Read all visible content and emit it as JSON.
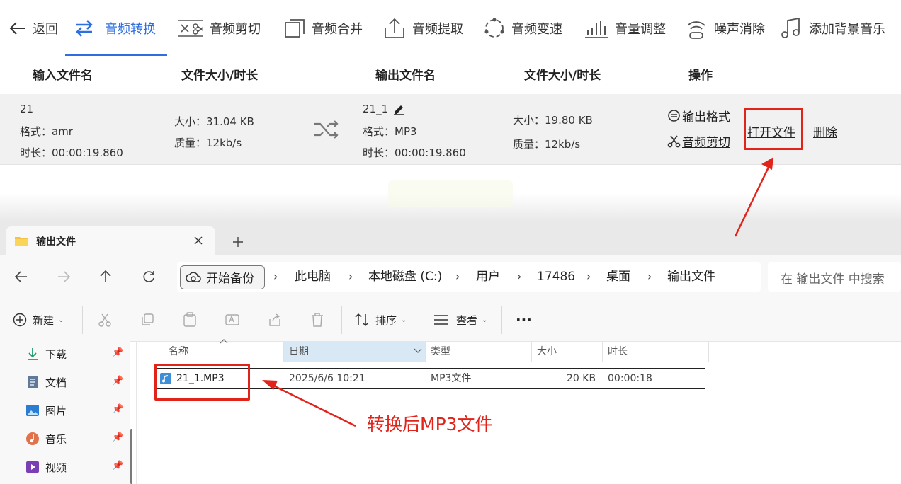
{
  "toolbar": {
    "back_label": "返回",
    "items": [
      {
        "label": "音频转换"
      },
      {
        "label": "音频剪切"
      },
      {
        "label": "音频合并"
      },
      {
        "label": "音频提取"
      },
      {
        "label": "音频变速"
      },
      {
        "label": "音量调整"
      },
      {
        "label": "噪声消除"
      },
      {
        "label": "添加背景音乐"
      }
    ]
  },
  "table": {
    "headers": [
      "输入文件名",
      "文件大小/时长",
      "输出文件名",
      "文件大小/时长",
      "操作"
    ],
    "row": {
      "input_name": "21",
      "input_format": "格式：amr",
      "input_duration": "时长：00:00:19.860",
      "input_size": "大小：31.04 KB",
      "input_quality": "质量：12kb/s",
      "output_name": "21_1",
      "output_format": "格式：MP3",
      "output_duration": "时长：00:00:19.860",
      "output_size": "大小：19.80 KB",
      "output_quality": "质量：12kb/s",
      "action_output_format": "输出格式",
      "action_audio_cut": "音频剪切",
      "action_open_file": "打开文件",
      "action_delete": "删除"
    }
  },
  "explorer": {
    "tab_title": "输出文件",
    "breadcrumb": [
      "开始备份",
      "此电脑",
      "本地磁盘 (C:)",
      "用户",
      "17486",
      "桌面",
      "输出文件"
    ],
    "search_placeholder": "在 输出文件 中搜索",
    "commands": {
      "new": "新建",
      "sort": "排序",
      "view": "查看",
      "more": "···"
    },
    "nav": [
      {
        "label": "下载"
      },
      {
        "label": "文档"
      },
      {
        "label": "图片"
      },
      {
        "label": "音乐"
      },
      {
        "label": "视频"
      }
    ],
    "columns": [
      "名称",
      "日期",
      "类型",
      "大小",
      "时长"
    ],
    "files": [
      {
        "name": "21_1.MP3",
        "date": "2025/6/6 10:21",
        "type": "MP3文件",
        "size": "20 KB",
        "duration": "00:00:18"
      }
    ]
  },
  "annotation": {
    "text": "转换后MP3文件",
    "color": "#e2231a"
  },
  "colors": {
    "accent": "#2e6fe0",
    "highlight": "#e2231a"
  }
}
